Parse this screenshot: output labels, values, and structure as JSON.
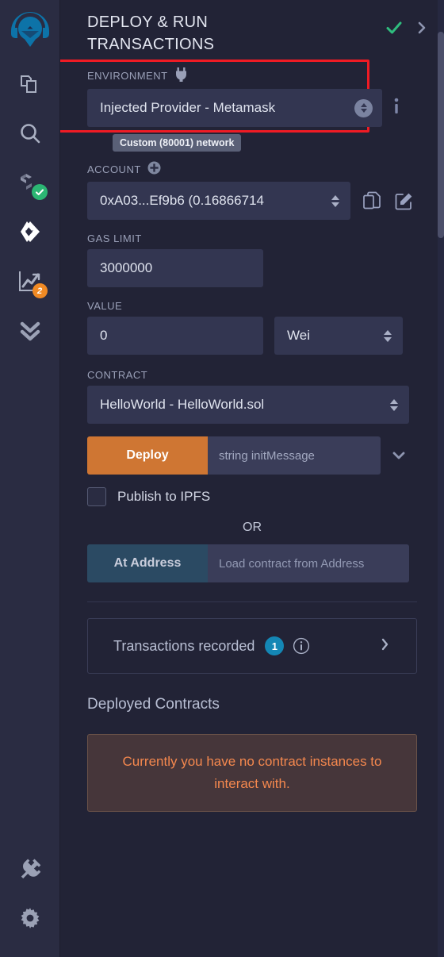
{
  "sidebar": {
    "items": [
      {
        "name": "remix-logo",
        "label": "Remix"
      },
      {
        "name": "file-explorer",
        "label": "File explorers"
      },
      {
        "name": "search",
        "label": "Search in files"
      },
      {
        "name": "solidity-compiler",
        "label": "Solidity compiler",
        "badge": ""
      },
      {
        "name": "deploy-run",
        "label": "Deploy & run transactions"
      },
      {
        "name": "debugger",
        "label": "Debugger",
        "badge": "2"
      },
      {
        "name": "check",
        "label": "Solidity unit testing"
      },
      {
        "name": "plugin-manager",
        "label": "Plugin manager"
      },
      {
        "name": "settings",
        "label": "Settings"
      }
    ]
  },
  "header": {
    "title": "DEPLOY & RUN TRANSACTIONS",
    "check_icon": "check-icon",
    "chevron_icon": "chevron-right-icon"
  },
  "environment": {
    "label": "ENVIRONMENT",
    "plug_icon": "plug-icon",
    "value": "Injected Provider - Metamask",
    "info_icon": "info-icon",
    "tooltip": "Custom (80001) network",
    "highlight_color": "#ef1b24"
  },
  "account": {
    "label": "ACCOUNT",
    "add_icon": "plus-circle-icon",
    "value": "0xA03...Ef9b6 (0.16866714",
    "copy_icon": "copy-icon",
    "edit_icon": "edit-icon"
  },
  "gas_limit": {
    "label": "GAS LIMIT",
    "value": "3000000"
  },
  "value_field": {
    "label": "VALUE",
    "value": "0",
    "unit": "Wei"
  },
  "contract": {
    "label": "CONTRACT",
    "value": "HelloWorld - HelloWorld.sol"
  },
  "deploy": {
    "button_label": "Deploy",
    "button_color": "#cf7633",
    "arg_placeholder": "string initMessage",
    "caret_icon": "chevron-down-icon",
    "ipfs_label": "Publish to IPFS",
    "ipfs_checked": false
  },
  "or_label": "OR",
  "at_address": {
    "button_label": "At Address",
    "button_color": "#2b4a63",
    "placeholder": "Load contract from Address"
  },
  "transactions": {
    "title": "Transactions recorded",
    "count": "1",
    "info_icon": "info-circle-icon",
    "chevron_icon": "chevron-right-icon",
    "badge_color": "#1487b5"
  },
  "deployed": {
    "title": "Deployed Contracts",
    "empty_message": "Currently you have no contract instances to interact with.",
    "empty_text_color": "#f5884e"
  }
}
